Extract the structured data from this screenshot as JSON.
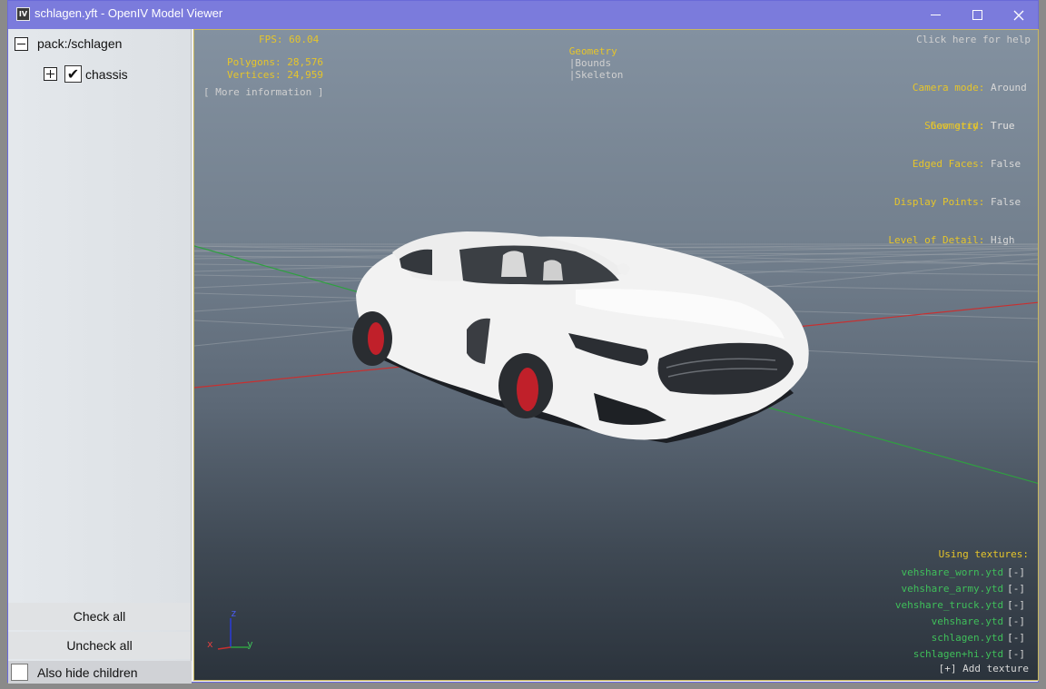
{
  "window": {
    "icon_text": "IV",
    "title": "schlagen.yft - OpenIV Model Viewer"
  },
  "tree": {
    "root_label": "pack:/schlagen",
    "child_label": "chassis"
  },
  "panel": {
    "check_all": "Check all",
    "uncheck_all": "Uncheck all",
    "also_hide_children": "Also hide children"
  },
  "viewport": {
    "fps_label": "FPS:",
    "fps_value": "60.04",
    "polygons_label": "Polygons:",
    "polygons_value": "28,576",
    "vertices_label": "Vertices:",
    "vertices_value": "24,959",
    "more_info": "[ More information ]",
    "tabs": [
      {
        "label": "Geometry",
        "active": true
      },
      {
        "label": "Bounds",
        "active": false
      },
      {
        "label": "Skeleton",
        "active": false
      }
    ],
    "tab_separator": "|",
    "help": "Click here for help",
    "settings_a": [
      {
        "label": "Camera mode:",
        "value": "Around"
      },
      {
        "label": "Show grid:",
        "value": "True"
      }
    ],
    "settings_b": [
      {
        "label": "Geometry:",
        "value": "True"
      },
      {
        "label": "Edged Faces:",
        "value": "False"
      },
      {
        "label": "Display Points:",
        "value": "False"
      },
      {
        "label": "Level of Detail:",
        "value": "High"
      }
    ],
    "textures_title": "Using textures:",
    "textures": [
      "vehshare_worn.ytd",
      "vehshare_army.ytd",
      "vehshare_truck.ytd",
      "vehshare.ytd",
      "schlagen.ytd",
      "schlagen+hi.ytd"
    ],
    "remove_label": "[-]",
    "add_texture": "[+] Add texture",
    "axes": {
      "x": "x",
      "y": "y",
      "z": "z"
    }
  },
  "colors": {
    "titlebar": "#7b7bdc",
    "hud_yellow": "#e6c52a",
    "texture_green": "#3fbf5a",
    "car_body": "#f2f2f2",
    "brake_caliper": "#c0202a"
  }
}
